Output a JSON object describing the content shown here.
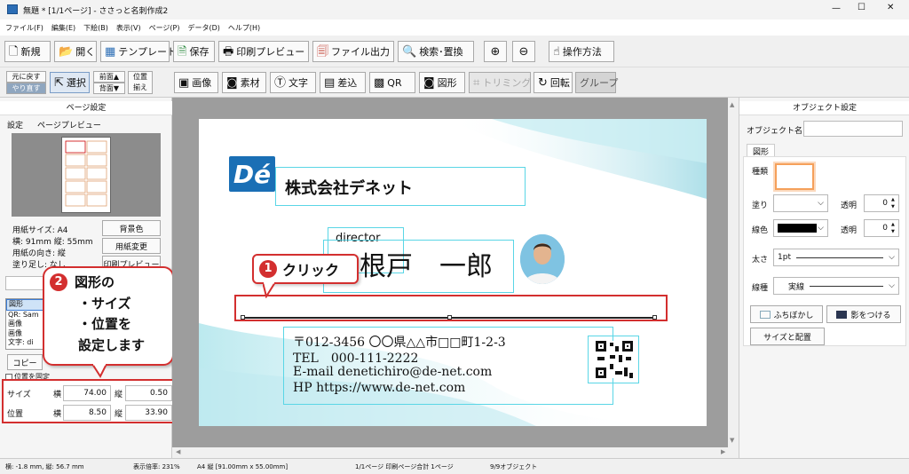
{
  "window": {
    "title": "無題 * [1/1ページ] - ささっと名刺作成2",
    "controls": [
      "—",
      "☐",
      "✕"
    ]
  },
  "menu": [
    "ファイル(F)",
    "編集(E)",
    "下絵(B)",
    "表示(V)",
    "ページ(P)",
    "データ(D)",
    "ヘルプ(H)"
  ],
  "toolbar1": {
    "new": "新規",
    "open": "開く",
    "template": "テンプレート",
    "save": "保存",
    "print_preview": "印刷プレビュー",
    "file_output": "ファイル出力",
    "search_replace": "検索･置換",
    "howto": "操作方法"
  },
  "toolbar2": {
    "undo": "元に戻す",
    "redo": "やり直す",
    "select": "選択",
    "front": "前面▲",
    "back": "背面▼",
    "align_top": "位置",
    "align_bottom": "揃え",
    "image": "画像",
    "material": "素材",
    "text": "文字",
    "merge": "差込",
    "qr": "QR",
    "shape": "図形",
    "trimming": "トリミング",
    "rotate": "回転",
    "group": "グループ"
  },
  "left_panel": {
    "header": "ページ設定",
    "tabs": [
      "設定",
      "ページプレビュー"
    ],
    "paper_size": "用紙サイズ: A4",
    "dims": "横: 91mm 縦: 55mm",
    "orientation": "用紙の向き: 縦",
    "bleed": "塗り足し: なし",
    "bg_color_btn": "背景色",
    "paper_change_btn": "用紙変更",
    "print_preview_btn": "印刷プレビュー",
    "object_list": [
      "図形",
      "QR: Sam",
      "画像",
      "画像",
      "文字: di"
    ],
    "copy_btn": "コピー",
    "lock_position": "位置を固定",
    "size_label": "サイズ",
    "pos_label": "位置",
    "w_label": "横",
    "h_label": "縦",
    "size_w": "74.00",
    "size_h": "0.50",
    "pos_x": "8.50",
    "pos_y": "33.90"
  },
  "card": {
    "logo": "Dé",
    "company": "株式会社デネット",
    "title": "director",
    "name": "根戸　一郎",
    "address": "〒012-3456 〇〇県△△市□□町1-2-3",
    "tel": "TEL　000-111-2222",
    "email": "E-mail  denetichiro@de-net.com",
    "hp": "HP  https://www.de-net.com"
  },
  "callout1": {
    "num": "1",
    "text": "クリック"
  },
  "callout2": {
    "num": "2",
    "lines": [
      "図形の",
      "・サイズ",
      "・位置を",
      "設定します"
    ]
  },
  "right_panel": {
    "header": "オブジェクト設定",
    "object_name_label": "オブジェクト名",
    "tab": "図形",
    "kind_label": "種類",
    "fill_label": "塗り",
    "transparency_label": "透明",
    "fill_transparency": "0",
    "line_color_label": "線色",
    "line_transparency": "0",
    "thickness_label": "太さ",
    "thickness_value": "1pt",
    "line_type_label": "線種",
    "line_type_value": "実線",
    "blur_btn": "ふちぼかし",
    "shadow_btn": "影をつける",
    "size_layout_btn": "サイズと配置",
    "accent_orange": "#f5a05a"
  },
  "status": {
    "coords": "横: -1.8 mm, 縦: 56.7 mm",
    "zoom": "表示倍率: 231%",
    "paper": "A4 縦 [91.00mm x 55.00mm]",
    "page": "1/1ページ 印刷ページ合計 1ページ",
    "objects": "9/9オブジェクト"
  },
  "colors": {
    "highlight": "#d32f2f",
    "guide": "#5ad6e6",
    "logo_blue": "#1a6fb5"
  }
}
